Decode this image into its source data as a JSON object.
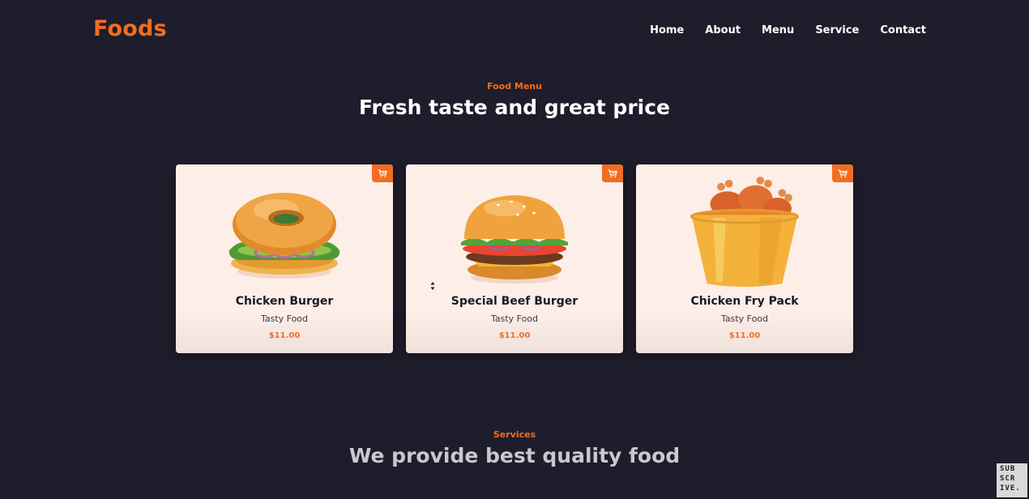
{
  "colors": {
    "background": "#1e1d2b",
    "accent": "#f26d21",
    "card_bg": "#fdeee8",
    "heading": "#ffffff",
    "muted_heading": "#c9c8d0"
  },
  "nav": {
    "logo": "Foods",
    "links": [
      "Home",
      "About",
      "Menu",
      "Service",
      "Contact"
    ]
  },
  "menu_section": {
    "eyebrow": "Food Menu",
    "title": "Fresh taste and great price"
  },
  "cards": [
    {
      "name": "Chicken Burger",
      "subtitle": "Tasty Food",
      "price": "$11.00",
      "image": "chicken-burger-illustration",
      "cart_icon": "cart-icon"
    },
    {
      "name": "Special Beef Burger",
      "subtitle": "Tasty Food",
      "price": "$11.00",
      "image": "beef-burger-illustration",
      "cart_icon": "cart-icon"
    },
    {
      "name": "Chicken Fry Pack",
      "subtitle": "Tasty Food",
      "price": "$11.00",
      "image": "fried-chicken-bucket-illustration",
      "cart_icon": "cart-icon"
    }
  ],
  "services_section": {
    "eyebrow": "Services",
    "title": "We provide best quality food"
  },
  "subscribe_badge": {
    "lines": [
      "SUB",
      "SCR",
      "IVE."
    ]
  }
}
